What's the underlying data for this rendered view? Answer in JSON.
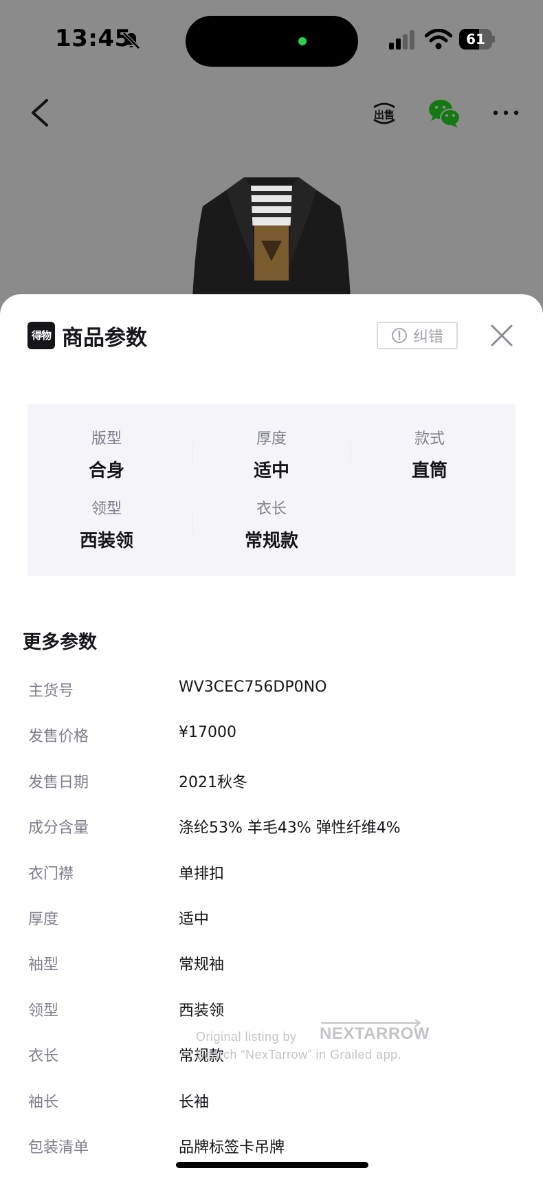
{
  "status_bar": {
    "time": "13:45",
    "battery_level": "61",
    "battery_fraction": 0.61
  },
  "nav": {
    "back_icon": "chevron-left-icon",
    "sell_icon": "sell-icon",
    "sell_label": "出售",
    "share_icon": "wechat-icon",
    "more_icon": "more-icon"
  },
  "sheet": {
    "brand_logo_text": "得物",
    "title": "商品参数",
    "report_button_label": "纠错",
    "close_icon": "close-icon"
  },
  "key_specs": [
    {
      "label": "版型",
      "value": "合身"
    },
    {
      "label": "厚度",
      "value": "适中"
    },
    {
      "label": "款式",
      "value": "直筒"
    },
    {
      "label": "领型",
      "value": "西装领"
    },
    {
      "label": "衣长",
      "value": "常规款"
    }
  ],
  "more_params": {
    "title": "更多参数",
    "rows": [
      {
        "label": "主货号",
        "value": "WV3CEC756DP0NO"
      },
      {
        "label": "发售价格",
        "value": "¥17000"
      },
      {
        "label": "发售日期",
        "value": "2021秋冬"
      },
      {
        "label": "成分含量",
        "value": "涤纶53% 羊毛43% 弹性纤维4%"
      },
      {
        "label": "衣门襟",
        "value": "单排扣"
      },
      {
        "label": "厚度",
        "value": "适中"
      },
      {
        "label": "袖型",
        "value": "常规袖"
      },
      {
        "label": "领型",
        "value": "西装领"
      },
      {
        "label": "衣长",
        "value": "常规款"
      },
      {
        "label": "袖长",
        "value": "长袖"
      },
      {
        "label": "包装清单",
        "value": "品牌标签卡吊牌"
      }
    ]
  },
  "watermark": {
    "line1": "Original listing by",
    "brand": "NEXTARROW",
    "line2": "Search “NexTarrow” in Grailed app."
  },
  "colors": {
    "overlay": "#8b8b8b",
    "text_primary": "#16161a",
    "text_secondary": "#7f7f8e",
    "card_bg": "#f5f5f9",
    "wechat_green": "#1aad19"
  }
}
